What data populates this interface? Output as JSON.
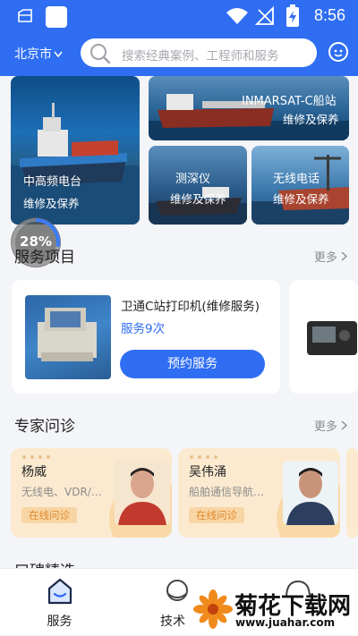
{
  "status_bar": {
    "time": "8:56",
    "icons": [
      "folder-icon",
      "app-square-icon",
      "wifi-icon",
      "no-signal-icon",
      "battery-charging-icon"
    ]
  },
  "header": {
    "city": "北京市",
    "search_placeholder": "搜索经典案例、工程师和服务",
    "accent_color": "#2f6ef3"
  },
  "banners": [
    {
      "title": "中高频电台",
      "subtitle": "维修及保养"
    },
    {
      "title": "INMARSAT-C船站",
      "subtitle": "维修及保养"
    },
    {
      "title": "测深仪",
      "subtitle": "维修及保养"
    },
    {
      "title": "无线电话",
      "subtitle": "维修及保养"
    }
  ],
  "progress": {
    "value": 0.28,
    "label": "28%"
  },
  "services": {
    "title": "服务项目",
    "more": "更多",
    "items": [
      {
        "name": "卫通C站打印机(维修服务)",
        "count": "服务9次",
        "button": "预约服务"
      }
    ]
  },
  "experts": {
    "title": "专家问诊",
    "more": "更多",
    "items": [
      {
        "name": "杨威",
        "desc": "无线电、VDR/…",
        "tag": "在线问诊"
      },
      {
        "name": "吴伟涌",
        "desc": "船舶通信导航…",
        "tag": "在线问诊"
      }
    ]
  },
  "next_section": {
    "title": "口碑精选"
  },
  "tabbar": {
    "items": [
      {
        "label": "服务",
        "icon": "service-home-icon",
        "active": true
      },
      {
        "label": "技术",
        "icon": "tech-icon",
        "active": false
      },
      {
        "label": "",
        "icon": "profile-icon",
        "active": false
      }
    ],
    "active_color": "#2f6ef3"
  },
  "watermark": {
    "text": "菊花下载网",
    "url": "www.juahar.com"
  }
}
